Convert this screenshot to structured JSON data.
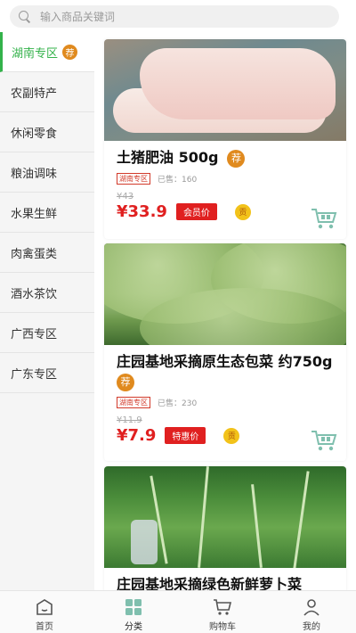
{
  "search": {
    "placeholder": "输入商品关键词"
  },
  "sidebar": {
    "badge": "荐",
    "items": [
      {
        "label": "湖南专区",
        "active": true
      },
      {
        "label": "农副特产"
      },
      {
        "label": "休闲零食"
      },
      {
        "label": "粮油调味"
      },
      {
        "label": "水果生鲜"
      },
      {
        "label": "肉禽蛋类"
      },
      {
        "label": "酒水茶饮"
      },
      {
        "label": "广西专区"
      },
      {
        "label": "广东专区"
      }
    ]
  },
  "products": [
    {
      "title": "土猪肥油 500g",
      "badge": "荐",
      "zone_tag": "湖南专区",
      "sold": "已售：160",
      "old_price": "¥43",
      "price": "¥33.9",
      "price_tag": "会员价",
      "gong": "贡"
    },
    {
      "title": "庄园基地采摘原生态包菜 约750g",
      "badge": "荐",
      "zone_tag": "湖南专区",
      "sold": "已售：230",
      "old_price": "¥11.9",
      "price": "¥7.9",
      "price_tag": "特惠价",
      "gong": "贡"
    },
    {
      "title": "庄园基地采摘绿色新鲜萝卜菜"
    }
  ],
  "tabbar": {
    "tabs": [
      {
        "label": "首页",
        "icon": "home-icon"
      },
      {
        "label": "分类",
        "icon": "category-icon",
        "active": true
      },
      {
        "label": "购物车",
        "icon": "cart-icon"
      },
      {
        "label": "我的",
        "icon": "profile-icon"
      }
    ]
  },
  "colors": {
    "accent": "#33b24a",
    "price": "#e02020",
    "badge": "#e08a1e"
  }
}
